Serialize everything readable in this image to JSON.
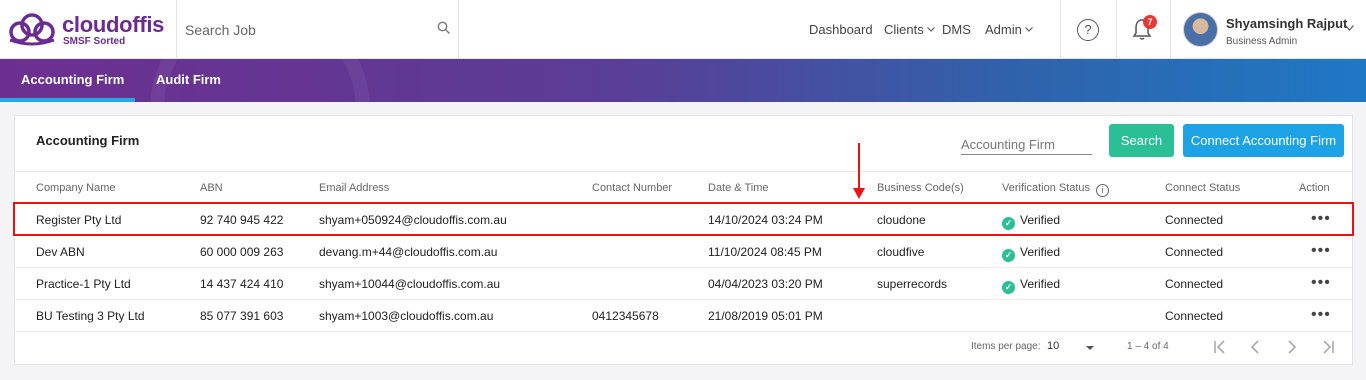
{
  "header": {
    "brand": "cloudoffis",
    "tagline": "SMSF Sorted",
    "search_placeholder": "Search Job",
    "nav": [
      {
        "label": "Dashboard"
      },
      {
        "label": "Clients"
      },
      {
        "label": "DMS"
      },
      {
        "label": "Admin"
      }
    ],
    "notification_count": "7",
    "help_glyph": "?",
    "user_name": "Shyamsingh Rajput",
    "user_role": "Business Admin"
  },
  "tabs": [
    {
      "label": "Accounting Firm",
      "active": true
    },
    {
      "label": "Audit Firm",
      "active": false
    }
  ],
  "card": {
    "title": "Accounting Firm",
    "filter_placeholder": "Accounting Firm",
    "search_button": "Search",
    "connect_button": "Connect Accounting Firm"
  },
  "table": {
    "columns": [
      "Company Name",
      "ABN",
      "Email Address",
      "Contact Number",
      "Date & Time",
      "Business Code(s)",
      "Verification Status",
      "Connect Status",
      "Action"
    ],
    "rows": [
      {
        "company": "Register Pty Ltd",
        "abn": "92 740 945 422",
        "email": "shyam+050924@cloudoffis.com.au",
        "contact": "",
        "datetime": "14/10/2024 03:24 PM",
        "code": "cloudone",
        "verification": "Verified",
        "status": "Connected"
      },
      {
        "company": "Dev ABN",
        "abn": "60 000 009 263",
        "email": "devang.m+44@cloudoffis.com.au",
        "contact": "",
        "datetime": "11/10/2024 08:45 PM",
        "code": "cloudfive",
        "verification": "Verified",
        "status": "Connected"
      },
      {
        "company": "Practice-1 Pty Ltd",
        "abn": "14 437 424 410",
        "email": "shyam+10044@cloudoffis.com.au",
        "contact": "",
        "datetime": "04/04/2023 03:20 PM",
        "code": "superrecords",
        "verification": "Verified",
        "status": "Connected"
      },
      {
        "company": "BU Testing 3 Pty Ltd",
        "abn": "85 077 391 603",
        "email": "shyam+1003@cloudoffis.com.au",
        "contact": "0412345678",
        "datetime": "21/08/2019 05:01 PM",
        "code": "",
        "verification": "",
        "status": "Connected"
      }
    ],
    "action_glyph": "•••"
  },
  "pagination": {
    "items_per_page_label": "Items per page:",
    "items_per_page": "10",
    "range": "1 – 4 of 4"
  },
  "colors": {
    "brand": "#6b2c91",
    "accent_green": "#2bbf96",
    "accent_blue": "#1ea2e6",
    "highlight_red": "#ee1111"
  }
}
